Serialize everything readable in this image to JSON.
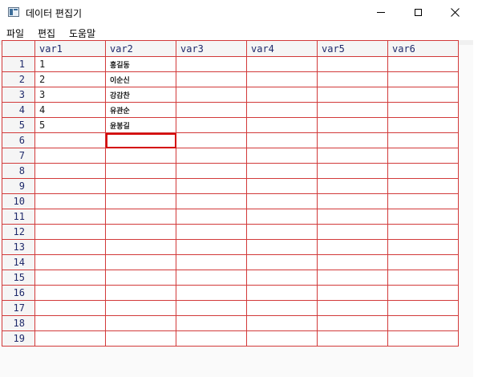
{
  "window": {
    "title": "데이터 편집기"
  },
  "menu": {
    "items": [
      "파일",
      "편집",
      "도움말"
    ]
  },
  "table": {
    "columns": [
      "var1",
      "var2",
      "var3",
      "var4",
      "var5",
      "var6"
    ],
    "row_numbers": [
      "1",
      "2",
      "3",
      "4",
      "5",
      "6",
      "7",
      "8",
      "9",
      "10",
      "11",
      "12",
      "13",
      "14",
      "15",
      "16",
      "17",
      "18",
      "19"
    ],
    "rows": [
      [
        "1",
        "홍길동",
        "",
        "",
        "",
        ""
      ],
      [
        "2",
        "이순신",
        "",
        "",
        "",
        ""
      ],
      [
        "3",
        "강감찬",
        "",
        "",
        "",
        ""
      ],
      [
        "4",
        "유관순",
        "",
        "",
        "",
        ""
      ],
      [
        "5",
        "윤봉길",
        "",
        "",
        "",
        ""
      ]
    ],
    "selected_cell": {
      "row": 6,
      "column": "var2"
    }
  },
  "colors": {
    "grid_line": "#d23a3a",
    "header_text": "#1f2a6b",
    "selection": "#d40000"
  }
}
